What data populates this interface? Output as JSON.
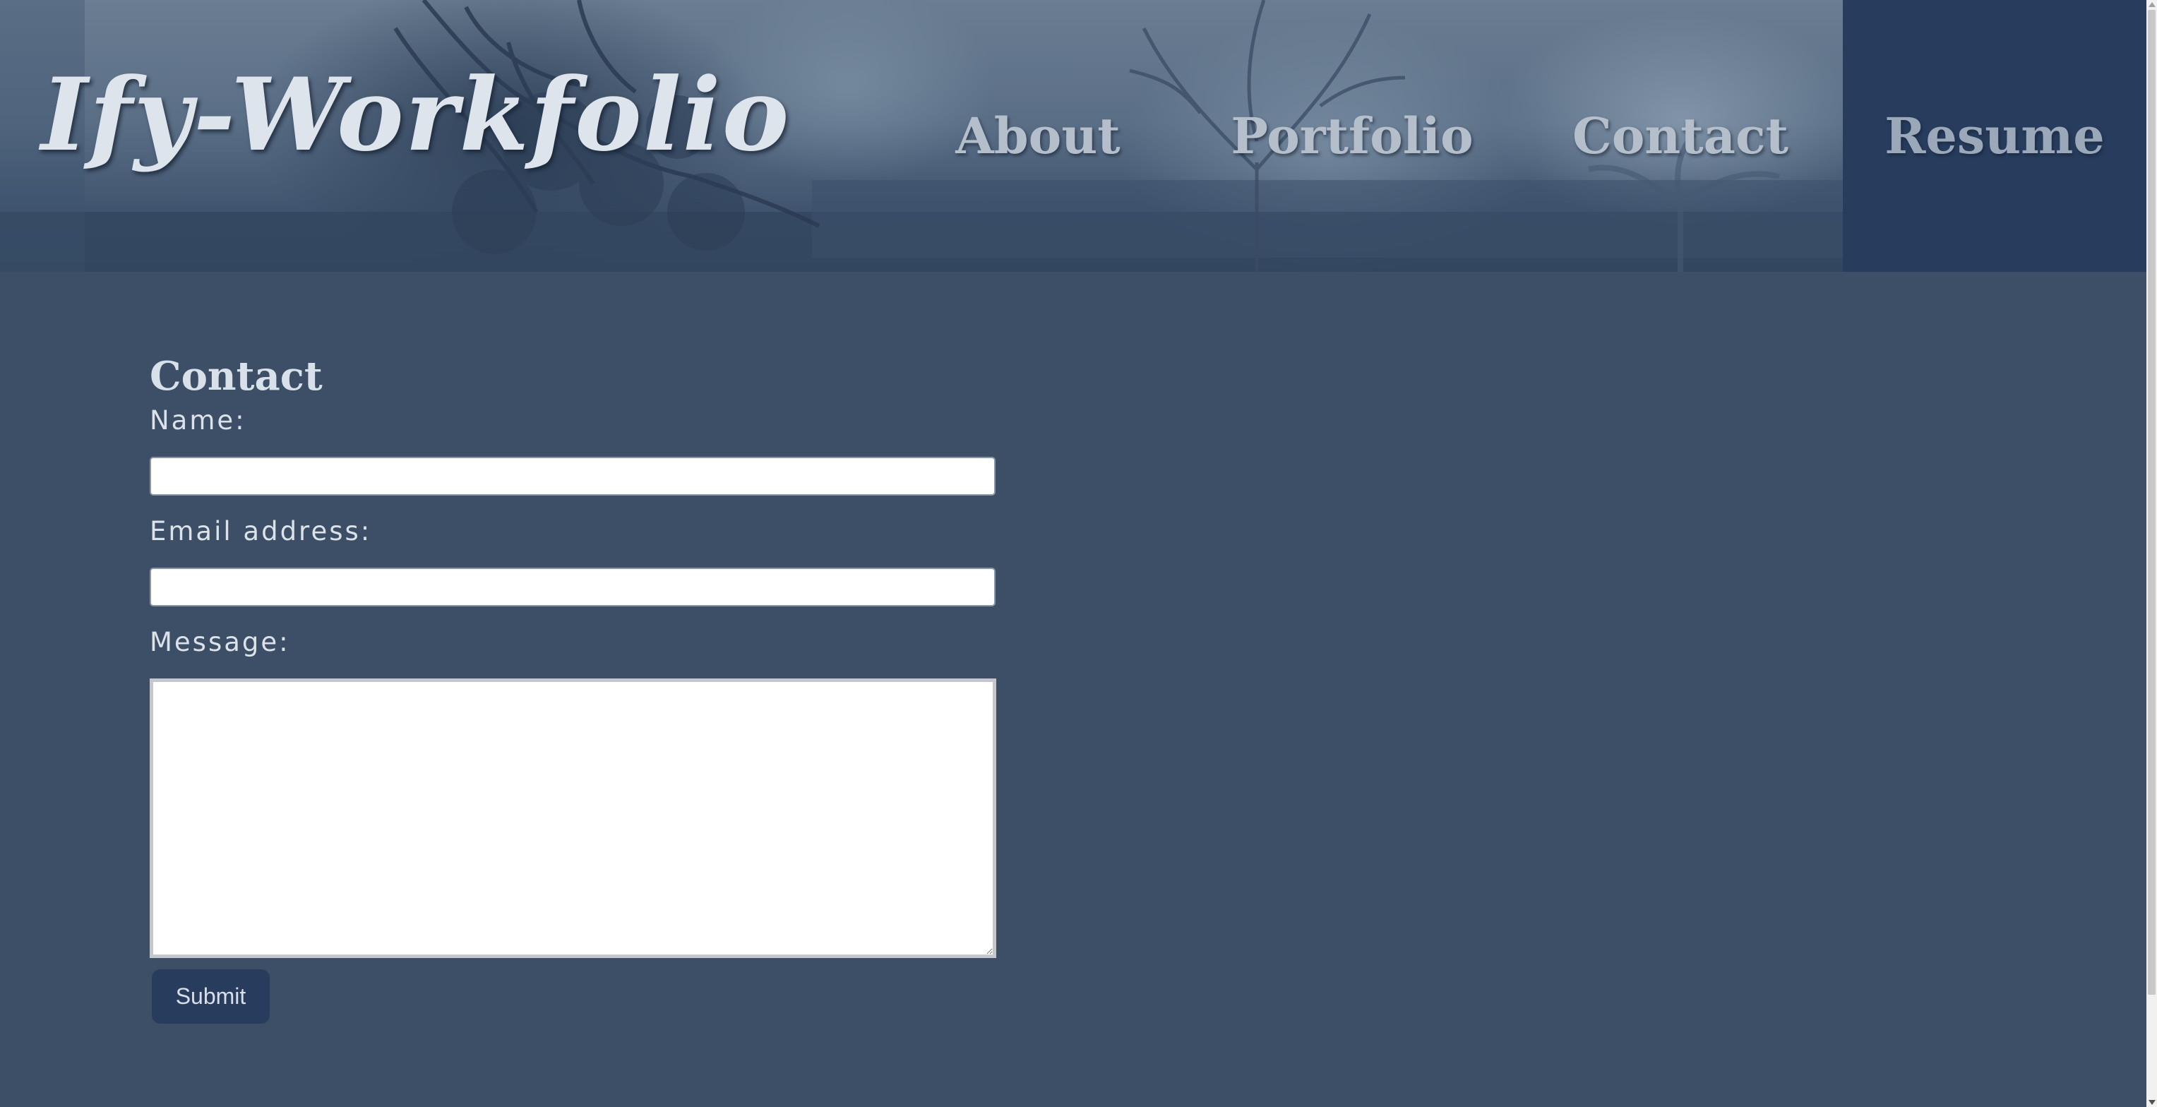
{
  "header": {
    "brand": "Ify-Workfolio",
    "nav": [
      {
        "label": "About"
      },
      {
        "label": "Portfolio"
      },
      {
        "label": "Contact"
      },
      {
        "label": "Resume"
      }
    ]
  },
  "contact_form": {
    "title": "Contact",
    "name_label": "Name:",
    "name_value": "",
    "email_label": "Email address:",
    "email_value": "",
    "message_label": "Message:",
    "message_value": "",
    "submit_label": "Submit"
  },
  "colors": {
    "page_background": "#3d4f66",
    "nav_active_background": "#283d5e",
    "button_background": "#283d5e",
    "text_light": "#dbe2ea"
  }
}
